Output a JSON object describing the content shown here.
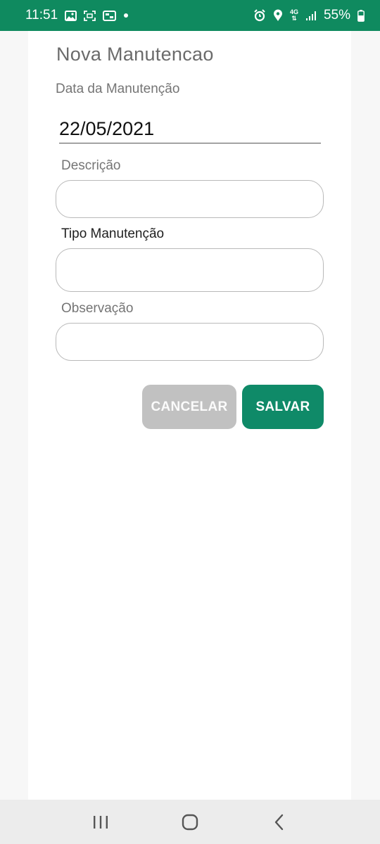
{
  "status_bar": {
    "time": "11:51",
    "battery": "55%",
    "network": "4G",
    "icons_left": [
      "gallery-icon",
      "screenshot-icon",
      "notification-icon",
      "dot-icon"
    ],
    "icons_right": [
      "alarm-icon",
      "location-icon",
      "4g-icon",
      "signal-icon",
      "battery-icon"
    ]
  },
  "form": {
    "title": "Nova Manutencao",
    "date_label": "Data da Manutenção",
    "date_value": "22/05/2021",
    "descricao_label": "Descrição",
    "descricao_value": "",
    "tipo_label": "Tipo Manutenção",
    "tipo_value": "",
    "observacao_label": "Observação",
    "observacao_value": ""
  },
  "actions": {
    "cancel_label": "CANCELAR",
    "save_label": "SALVAR"
  },
  "colors": {
    "status_bar": "#0f8a5f",
    "primary": "#0f8a68",
    "disabled": "#c1c1c1"
  },
  "nav_bar": {
    "buttons": [
      "recent-apps-icon",
      "home-icon",
      "back-icon"
    ]
  }
}
